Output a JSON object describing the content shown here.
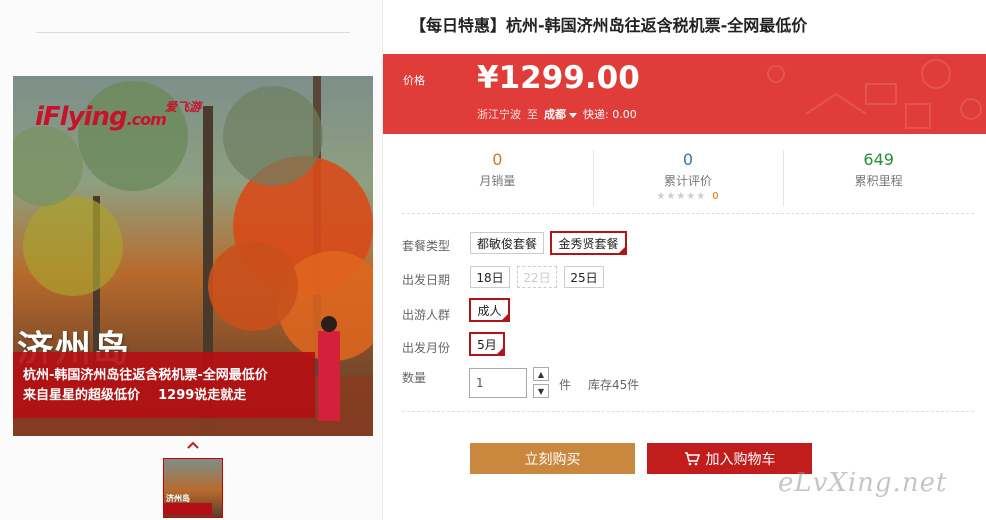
{
  "product": {
    "title": "【每日特惠】杭州-韩国济州岛往返含税机票-全网最低价",
    "image": {
      "brand": "iFlying",
      "brand_suffix": ".com",
      "brand_cn": "爱飞游",
      "big_text": "济州岛",
      "banner_line1": "杭州-韩国济州岛往返含税机票-全网最低价",
      "banner_line2": "来自星星的超级低价    1299说走就走"
    }
  },
  "price": {
    "label": "价格",
    "value": "¥1299.00",
    "origin": "浙江宁波",
    "to": "至",
    "destination": "成都",
    "shipping": "快递: 0.00"
  },
  "stats": [
    {
      "value": "0",
      "label": "月销量"
    },
    {
      "value": "0",
      "label": "累计评价",
      "stars": "★★★★★",
      "review_count": "0"
    },
    {
      "value": "649",
      "label": "累积里程"
    }
  ],
  "options": {
    "package": {
      "label": "套餐类型",
      "items": [
        "都敏俊套餐",
        "金秀贤套餐"
      ],
      "selected": "金秀贤套餐"
    },
    "date": {
      "label": "出发日期",
      "items": [
        "18日",
        "22日",
        "25日"
      ],
      "disabled": "22日"
    },
    "group": {
      "label": "出游人群",
      "items": [
        "成人"
      ],
      "selected": "成人"
    },
    "month": {
      "label": "出发月份",
      "items": [
        "5月"
      ],
      "selected": "5月"
    },
    "quantity": {
      "label": "数量",
      "value": "1",
      "unit": "件",
      "stock": "库存45件"
    }
  },
  "buttons": {
    "buy": "立刻购买",
    "cart": "加入购物车"
  },
  "watermark": "eLvXing.net",
  "colors": {
    "price_bg": "#e03c3a",
    "buy": "#c9883e",
    "cart": "#c21d1d",
    "selected_border": "#b21519"
  }
}
